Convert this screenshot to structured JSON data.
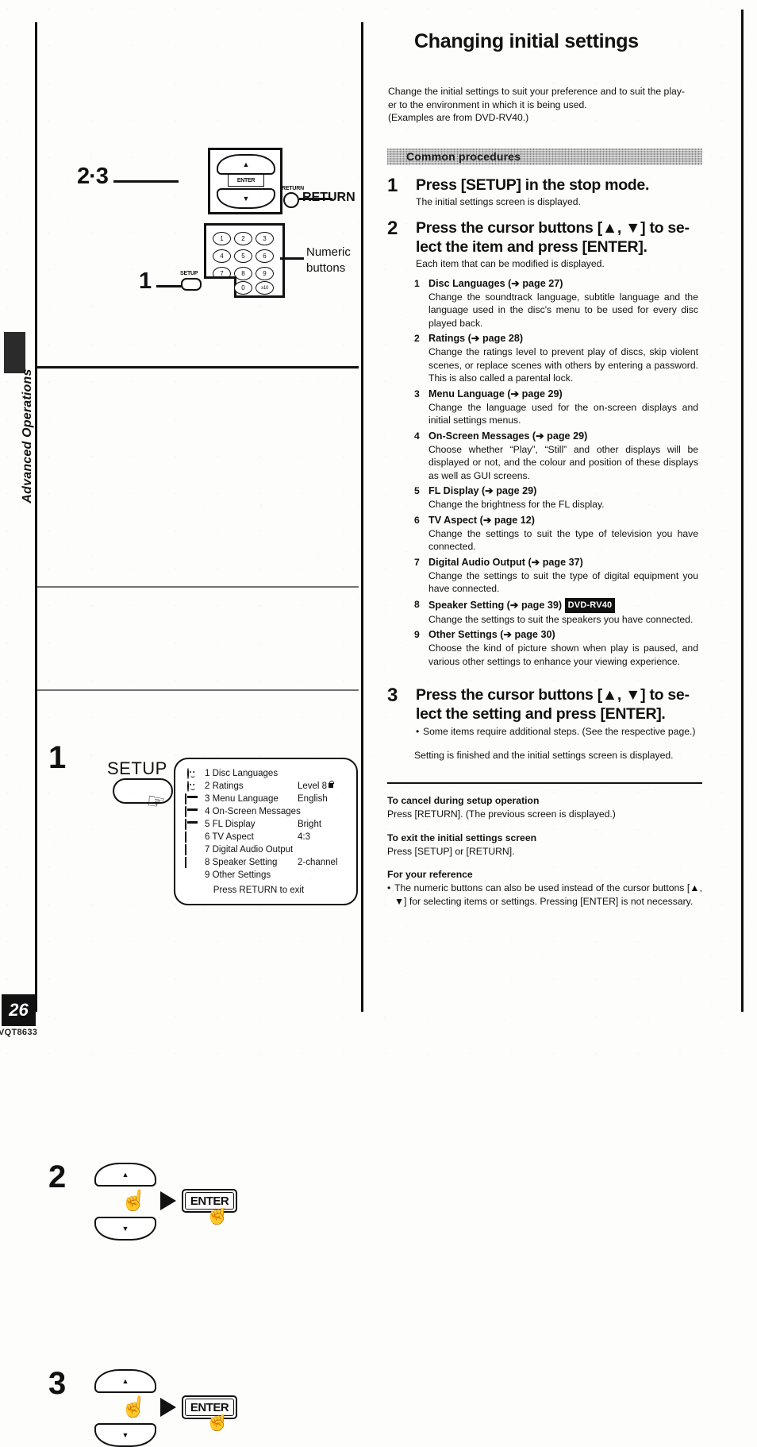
{
  "page": {
    "number": "26",
    "code": "VQT8633",
    "sidebar_label": "Advanced Operations"
  },
  "title": "Changing initial settings",
  "intro": {
    "line1": "Change the initial settings to suit your preference and to suit the play-",
    "line2": "er to the environment in which it is being used.",
    "line3": "(Examples are from DVD-RV40.)"
  },
  "section_band": "Common procedures",
  "steps": [
    {
      "number": "1",
      "heading": "Press [SETUP] in the stop mode.",
      "sub": "The initial settings screen is displayed."
    },
    {
      "number": "2",
      "heading_line1": "Press the cursor buttons [▲, ▼] to se-",
      "heading_line2": "lect the item and press [ENTER].",
      "sub": "Each item that can be modified is displayed."
    },
    {
      "number": "3",
      "heading_line1": "Press the cursor buttons [▲, ▼] to se-",
      "heading_line2": "lect the setting and press [ENTER].",
      "bullet": "Some items require additional steps. (See the respective page.)",
      "finish": "Setting is finished and the initial settings screen is displayed."
    }
  ],
  "items": [
    {
      "n": "1",
      "name": "Disc Languages",
      "ref": "page 27",
      "desc": "Change the soundtrack language, subtitle language and the language used in the disc's menu to be used for every disc played back."
    },
    {
      "n": "2",
      "name": "Ratings",
      "ref": "page 28",
      "desc": "Change the ratings level to prevent play of discs, skip violent scenes, or replace scenes with others by entering a password. This is also called a parental lock."
    },
    {
      "n": "3",
      "name": "Menu Language",
      "ref": "page 29",
      "desc": "Change the language used for the on-screen displays and initial settings menus."
    },
    {
      "n": "4",
      "name": "On-Screen Messages",
      "ref": "page 29",
      "desc": "Choose whether “Play”, “Still” and other displays will be displayed or not, and the colour and position of these displays as well as GUI screens."
    },
    {
      "n": "5",
      "name": "FL Display",
      "ref": "page 29",
      "desc": "Change the brightness for the FL display."
    },
    {
      "n": "6",
      "name": "TV Aspect",
      "ref": "page 12",
      "desc": "Change the settings to suit the type of television you have connected."
    },
    {
      "n": "7",
      "name": "Digital Audio Output",
      "ref": "page 37",
      "desc": "Change the settings to suit the type of digital equipment you have connected."
    },
    {
      "n": "8",
      "name": "Speaker Setting",
      "ref": "page 39",
      "badge": "DVD-RV40",
      "desc": "Change the settings to suit the speakers you have connected."
    },
    {
      "n": "9",
      "name": "Other Settings",
      "ref": "page 30",
      "desc": "Choose the kind of picture shown when play is paused, and various other settings to enhance your viewing experience."
    }
  ],
  "notes": [
    {
      "heading": "To cancel during setup operation",
      "body": "Press [RETURN]. (The previous screen is displayed.)"
    },
    {
      "heading": "To exit the initial settings screen",
      "body": "Press [SETUP] or [RETURN]."
    },
    {
      "heading": "For your reference",
      "bullet": "The numeric buttons can also be used instead of the cursor buttons [▲, ▼] for selecting items or settings. Pressing [ENTER] is not necessary."
    }
  ],
  "remote_diagram": {
    "callout_cursor": "2·3",
    "callout_setup": "1",
    "enter_label": "ENTER",
    "return_small_label": "RETURN",
    "return_callout": "RETURN",
    "numeric_callout_line1": "Numeric",
    "numeric_callout_line2": "buttons",
    "setup_small_label": "SETUP",
    "keys": [
      "1",
      "2",
      "3",
      "4",
      "5",
      "6",
      "7",
      "8",
      "9",
      "0",
      "≥10"
    ]
  },
  "step1_art": {
    "setup_word": "SETUP"
  },
  "osd_menu": {
    "rows": [
      {
        "icon": "face-icon",
        "n": "1",
        "label": "Disc Languages",
        "value": ""
      },
      {
        "icon": "face-icon",
        "n": "2",
        "label": "Ratings",
        "value": "Level 8",
        "lock": true
      },
      {
        "icon": "bar-icon",
        "n": "3",
        "label": "Menu Language",
        "value": "English"
      },
      {
        "icon": "bar-icon",
        "n": "4",
        "label": "On-Screen Messages",
        "value": ""
      },
      {
        "icon": "bar-icon",
        "n": "5",
        "label": "FL Display",
        "value": "Bright"
      },
      {
        "icon": "grid-icon",
        "n": "6",
        "label": "TV Aspect",
        "value": "4:3"
      },
      {
        "icon": "grid-icon",
        "n": "7",
        "label": "Digital Audio Output",
        "value": ""
      },
      {
        "icon": "grid-icon",
        "n": "8",
        "label": "Speaker Setting",
        "value": "2-channel"
      },
      {
        "icon": "none",
        "n": "9",
        "label": "Other Settings",
        "value": ""
      }
    ],
    "footer": "Press RETURN to exit"
  },
  "enter_button_label": "ENTER"
}
